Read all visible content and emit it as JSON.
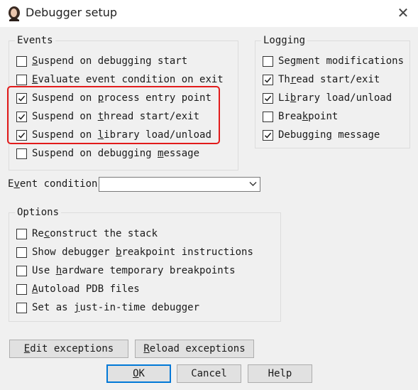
{
  "window": {
    "title": "Debugger setup",
    "close_glyph": "✕"
  },
  "events": {
    "title": "Events",
    "items": [
      {
        "pre": "",
        "key": "S",
        "post": "uspend on debugging start",
        "checked": false
      },
      {
        "pre": "",
        "key": "E",
        "post": "valuate event condition on exit",
        "checked": false
      },
      {
        "pre": "Suspend on ",
        "key": "p",
        "post": "rocess entry point",
        "checked": true
      },
      {
        "pre": "Suspend on ",
        "key": "t",
        "post": "hread start/exit",
        "checked": true
      },
      {
        "pre": "Suspend on ",
        "key": "l",
        "post": "ibrary load/unload",
        "checked": true
      },
      {
        "pre": "Suspend on debugging ",
        "key": "m",
        "post": "essage",
        "checked": false
      }
    ]
  },
  "logging": {
    "title": "Logging",
    "items": [
      {
        "pre": "Se",
        "key": "g",
        "post": "ment modifications",
        "checked": false
      },
      {
        "pre": "Th",
        "key": "r",
        "post": "ead start/exit",
        "checked": true
      },
      {
        "pre": "Li",
        "key": "b",
        "post": "rary load/unload",
        "checked": true
      },
      {
        "pre": "Brea",
        "key": "k",
        "post": "point",
        "checked": false
      },
      {
        "pre": "Debuggin",
        "key": "g",
        "post": " message",
        "checked": true
      }
    ]
  },
  "event_condition": {
    "pre": "E",
    "key": "v",
    "post": "ent condition",
    "value": ""
  },
  "options": {
    "title": "Options",
    "items": [
      {
        "pre": "Re",
        "key": "c",
        "post": "onstruct the stack",
        "checked": false
      },
      {
        "pre": "Show debugger ",
        "key": "b",
        "post": "reakpoint instructions",
        "checked": false
      },
      {
        "pre": "Use ",
        "key": "h",
        "post": "ardware temporary breakpoints",
        "checked": false
      },
      {
        "pre": "",
        "key": "A",
        "post": "utoload PDB files",
        "checked": false
      },
      {
        "pre": "Set as ",
        "key": "j",
        "post": "ust-in-time debugger",
        "checked": false
      }
    ]
  },
  "buttons": {
    "edit_exceptions": {
      "pre": "",
      "key": "E",
      "post": "dit exceptions"
    },
    "reload_exceptions": {
      "pre": "",
      "key": "R",
      "post": "eload exceptions"
    },
    "ok": {
      "pre": "",
      "key": "O",
      "post": "K"
    },
    "cancel": {
      "pre": "Cancel",
      "key": "",
      "post": ""
    },
    "help": {
      "pre": "Help",
      "key": "",
      "post": ""
    }
  },
  "colors": {
    "highlight": "#e21b1b",
    "dialog_bg": "#f0f0f0",
    "button_bg": "#e1e1e1"
  }
}
